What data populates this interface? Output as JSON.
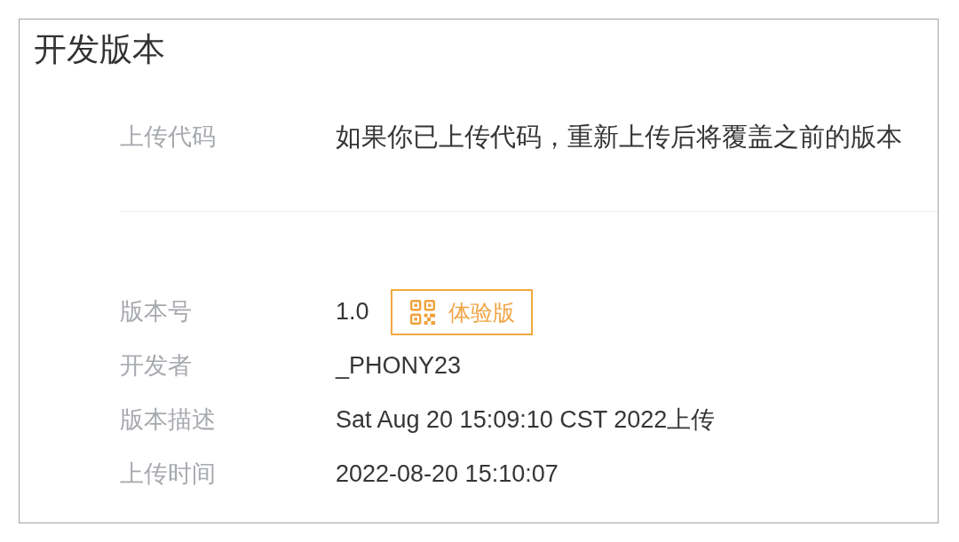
{
  "section": {
    "title": "开发版本"
  },
  "upload": {
    "label": "上传代码",
    "text": "如果你已上传代码，重新上传后将覆盖之前的版本"
  },
  "details": [
    {
      "label": "版本号",
      "value": "1.0",
      "button": "体验版"
    },
    {
      "label": "开发者",
      "value": "_PHONY23"
    },
    {
      "label": "版本描述",
      "value": "Sat Aug 20 15:09:10 CST 2022上传"
    },
    {
      "label": "上传时间",
      "value": "2022-08-20 15:10:07"
    }
  ]
}
